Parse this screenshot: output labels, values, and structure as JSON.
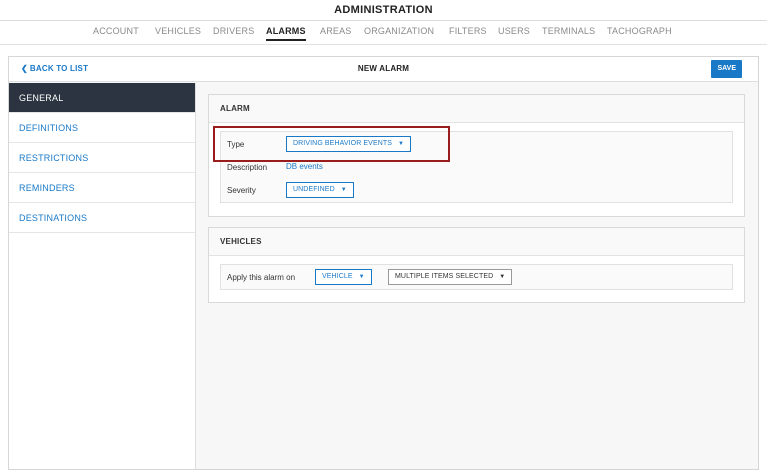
{
  "app": {
    "title": "ADMINISTRATION"
  },
  "tabs": [
    {
      "label": "ACCOUNT"
    },
    {
      "label": "VEHICLES"
    },
    {
      "label": "DRIVERS"
    },
    {
      "label": "ALARMS"
    },
    {
      "label": "AREAS"
    },
    {
      "label": "ORGANIZATION"
    },
    {
      "label": "FILTERS"
    },
    {
      "label": "USERS"
    },
    {
      "label": "TERMINALS"
    },
    {
      "label": "TACHOGRAPH"
    }
  ],
  "header": {
    "back_label": "BACK TO LIST",
    "back_icon": "chevron-left-icon",
    "title": "NEW ALARM",
    "save_label": "SAVE"
  },
  "sidebar": {
    "items": [
      {
        "label": "GENERAL"
      },
      {
        "label": "DEFINITIONS"
      },
      {
        "label": "RESTRICTIONS"
      },
      {
        "label": "REMINDERS"
      },
      {
        "label": "DESTINATIONS"
      }
    ]
  },
  "alarm_panel": {
    "heading": "ALARM",
    "type_label": "Type",
    "type_value": "DRIVING BEHAVIOR EVENTS",
    "description_label": "Description",
    "description_value": "DB events",
    "severity_label": "Severity",
    "severity_value": "UNDEFINED"
  },
  "vehicles_panel": {
    "heading": "VEHICLES",
    "apply_label": "Apply this alarm on",
    "target_value": "VEHICLE",
    "items_value": "MULTIPLE ITEMS SELECTED"
  },
  "colors": {
    "accent": "#1a79c7",
    "sidebar_active": "#2b3440",
    "highlight": "#9b1c1c"
  }
}
